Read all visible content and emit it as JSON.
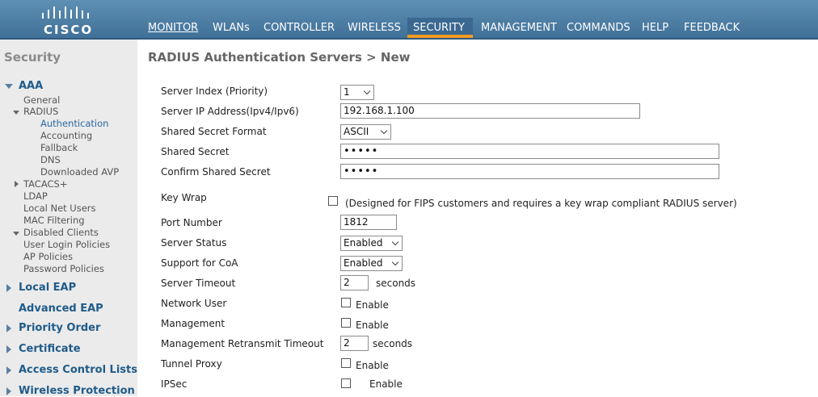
{
  "brand": {
    "logo_text": "CISCO"
  },
  "nav": {
    "monitor": "MONITOR",
    "wlans": "WLANs",
    "controller": "CONTROLLER",
    "wireless": "WIRELESS",
    "security": "SECURITY",
    "management": "MANAGEMENT",
    "commands": "COMMANDS",
    "help": "HELP",
    "feedback": "FEEDBACK",
    "active": "SECURITY",
    "active_color": "#f29a22"
  },
  "sidebar": {
    "title": "Security",
    "aaa": "AAA",
    "general": "General",
    "radius": "RADIUS",
    "authentication": "Authentication",
    "accounting": "Accounting",
    "fallback": "Fallback",
    "dns": "DNS",
    "downloaded_avp": "Downloaded AVP",
    "tacacs": "TACACS+",
    "ldap": "LDAP",
    "local_net_users": "Local Net Users",
    "mac_filtering": "MAC Filtering",
    "disabled_clients": "Disabled Clients",
    "user_login_policies": "User Login Policies",
    "ap_policies": "AP Policies",
    "password_policies": "Password Policies",
    "local_eap": "Local EAP",
    "advanced_eap": "Advanced EAP",
    "priority_order": "Priority Order",
    "certificate": "Certificate",
    "access_control_lists": "Access Control Lists",
    "wireless_protection": "Wireless Protection"
  },
  "page": {
    "title": "RADIUS Authentication Servers > New"
  },
  "form": {
    "server_index_label": "Server Index (Priority)",
    "server_index_value": "1",
    "server_ip_label": "Server IP Address(Ipv4/Ipv6)",
    "server_ip_value": "192.168.1.100",
    "secret_format_label": "Shared Secret Format",
    "secret_format_value": "ASCII",
    "shared_secret_label": "Shared Secret",
    "shared_secret_value": "•••••",
    "confirm_secret_label": "Confirm Shared Secret",
    "confirm_secret_value": "•••••",
    "key_wrap_label": "Key Wrap",
    "key_wrap_note": "(Designed for FIPS customers and requires a key wrap compliant RADIUS server)",
    "port_label": "Port Number",
    "port_value": "1812",
    "server_status_label": "Server Status",
    "server_status_value": "Enabled",
    "coa_label": "Support for CoA",
    "coa_value": "Enabled",
    "timeout_label": "Server Timeout",
    "timeout_value": "2",
    "timeout_unit": "seconds",
    "network_user_label": "Network User",
    "network_user_enable": "Enable",
    "management_label": "Management",
    "management_enable": "Enable",
    "mgmt_retransmit_label": "Management Retransmit Timeout",
    "mgmt_retransmit_value": "2",
    "mgmt_retransmit_unit": "seconds",
    "tunnel_proxy_label": "Tunnel Proxy",
    "tunnel_proxy_enable": "Enable",
    "ipsec_label": "IPSec",
    "ipsec_enable": "Enable"
  }
}
